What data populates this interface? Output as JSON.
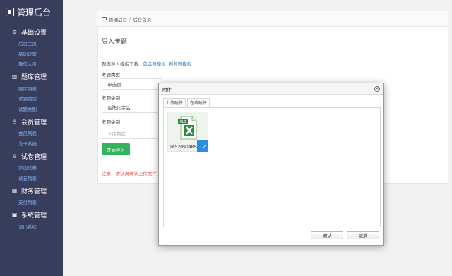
{
  "sidebar": {
    "app_title": "管理后台",
    "groups": [
      {
        "title": "基础设置",
        "icon": "gear-icon",
        "items": [
          "后台主页",
          "基础设置",
          "操作人员"
        ]
      },
      {
        "title": "题库管理",
        "icon": "books-icon",
        "items": [
          "题库列表",
          "试题类型",
          "试题类别"
        ]
      },
      {
        "title": "会员管理",
        "icon": "user-icon",
        "items": [
          "会员列表",
          "发卡系统"
        ]
      },
      {
        "title": "试卷管理",
        "icon": "user-icon",
        "items": [
          "添加试卷",
          "试卷列表"
        ]
      },
      {
        "title": "财务管理",
        "icon": "finance-icon",
        "items": [
          "支付列表"
        ]
      },
      {
        "title": "系统管理",
        "icon": "monitor-icon",
        "items": [
          "退出系统"
        ]
      }
    ]
  },
  "breadcrumb": {
    "root": "管理后台",
    "separator": "/",
    "current": "后台首页"
  },
  "page": {
    "title": "导入考题",
    "template_prefix": "题库导入模板下载:",
    "template_single": "单选题模板",
    "template_judge": "判断题模板",
    "type_label": "考题类型",
    "type_value": "单选题",
    "category_label": "考题类别",
    "category_value": "色陆化字品",
    "category2_label": "考题类别",
    "upload_placeholder": "上传题库",
    "start_button": "开始导入",
    "note": "注意：请认真确认上传文件"
  },
  "dialog": {
    "title": "附件",
    "close_glyph": "×",
    "tabs": [
      "上传附件",
      "在线附件"
    ],
    "file_name": "1652090485479",
    "confirm": "确认",
    "cancel": "取消"
  },
  "colors": {
    "sidebar_bg": "#393d5c",
    "submenu_link": "#7fb2ef",
    "primary_green": "#35b35c",
    "selected_blue": "#2d8de0",
    "warning_red": "#e8483c"
  }
}
